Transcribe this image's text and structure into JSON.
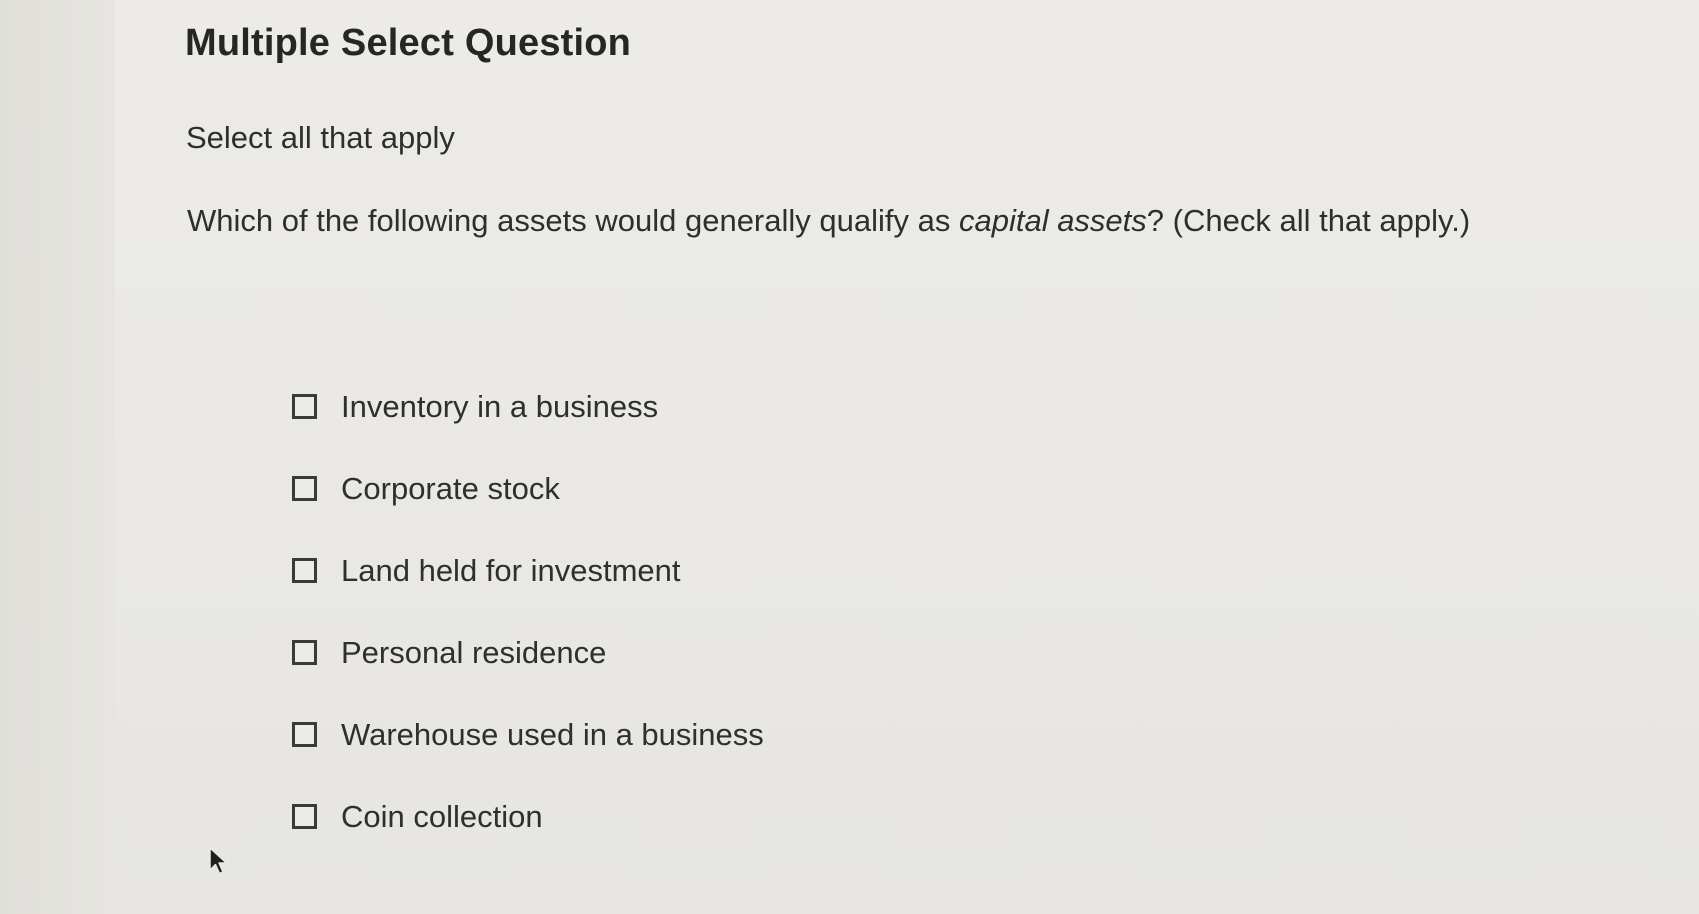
{
  "question": {
    "title": "Multiple Select Question",
    "instruction": "Select all that apply",
    "prompt_before": "Which of the following assets would generally qualify as ",
    "prompt_emphasis": "capital assets",
    "prompt_after": "? (Check all that apply.)"
  },
  "options": [
    {
      "label": "Inventory in a business",
      "checked": false
    },
    {
      "label": "Corporate stock",
      "checked": false
    },
    {
      "label": "Land held for investment",
      "checked": false
    },
    {
      "label": "Personal residence",
      "checked": false
    },
    {
      "label": "Warehouse used in a business",
      "checked": false
    },
    {
      "label": "Coin collection",
      "checked": false
    }
  ],
  "icons": {
    "cursor": "mouse-pointer-icon"
  },
  "colors": {
    "background": "#e9e8e4",
    "text": "#2b2b2b",
    "checkbox_border": "#3a3a3a"
  }
}
